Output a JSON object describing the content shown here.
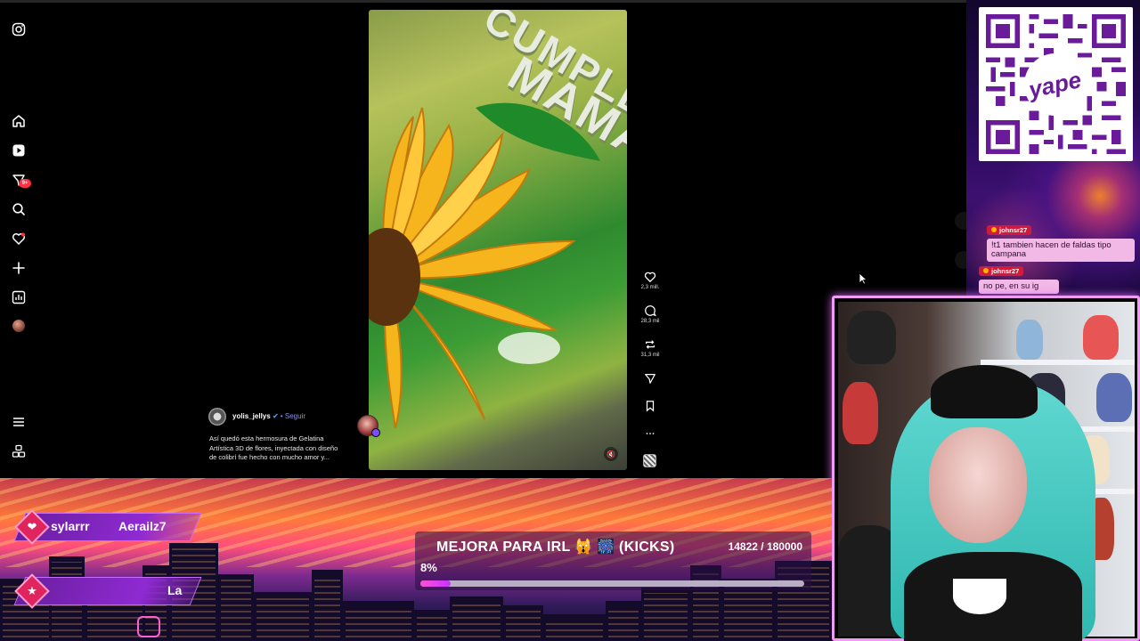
{
  "instagram": {
    "post": {
      "username": "yolis_jellys",
      "follow_label": "• Seguir",
      "caption_lines": [
        "Así quedó esta hermosura de Gelatina",
        "Artística 3D de flores, inyectada con diseño",
        "de colibrí fue hecho con mucho amor y..."
      ]
    },
    "video_text": [
      "CUMPLE",
      "MAMA"
    ],
    "notifications_badge": "9+",
    "actions": {
      "likes": "2,3 mill.",
      "comments": "28,3 mil",
      "reposts": "31,3 mil"
    }
  },
  "overlay": {
    "qr_brand": "yape",
    "chat": [
      {
        "user": "johnsr27",
        "text": "!t1 tambien hacen de faldas tipo campana"
      },
      {
        "user": "johnsr27",
        "text": "no pe, en su ig"
      }
    ],
    "alerts": [
      {
        "left": "sylarrr",
        "right": "Aerailz7",
        "icon": "heart-icon"
      },
      {
        "left": "",
        "right": "La",
        "icon": "star-icon"
      }
    ],
    "goal": {
      "title": "MEJORA PARA IRL 🙀 🎆 (KICKS)",
      "progress_text": "14822 / 180000",
      "percent_text": "8%",
      "progress_fraction": 0.08
    }
  },
  "colors": {
    "webcam_border": "#f19bf4",
    "chat_name_bg": "#d01b3c",
    "chat_text_bg": "#f2b8e6",
    "goal_fill": "#ff4fd6"
  }
}
